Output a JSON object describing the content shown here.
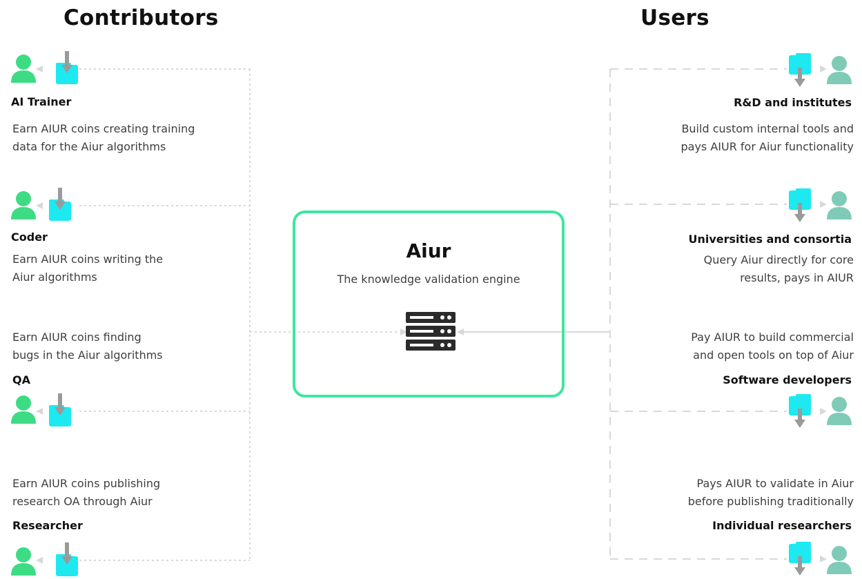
{
  "headings": {
    "contributors": "Contributors",
    "users": "Users"
  },
  "center": {
    "title": "Aiur",
    "subtitle": "The knowledge validation engine"
  },
  "contributors": [
    {
      "role": "AI Trainer",
      "desc": [
        "Earn AIUR coins creating training",
        "data for the Aiur algorithms"
      ]
    },
    {
      "role": "Coder",
      "desc": [
        "Earn AIUR coins writing the",
        "Aiur algorithms"
      ]
    },
    {
      "role": "QA",
      "desc": [
        "Earn AIUR coins finding",
        "bugs in the Aiur algorithms"
      ]
    },
    {
      "role": "Researcher",
      "desc": [
        "Earn AIUR coins publishing",
        "research OA through Aiur"
      ]
    }
  ],
  "users": [
    {
      "role": "R&D and institutes",
      "desc": [
        "Build custom internal tools and",
        "pays AIUR for Aiur functionality"
      ]
    },
    {
      "role": "Universities and consortia",
      "desc": [
        "Query Aiur directly for core",
        "results, pays in AIUR"
      ]
    },
    {
      "role": "Software developers",
      "desc": [
        "Pay AIUR to build commercial",
        "and open tools on top of Aiur"
      ]
    },
    {
      "role": "Individual researchers",
      "desc": [
        "Pays AIUR to validate in Aiur",
        "before  publishing traditionally"
      ]
    }
  ],
  "colors": {
    "contributor_person": "#3ddc84",
    "wallet": "#1de9f0",
    "user_person": "#7fcbb7",
    "box_border": "#3ee6a0",
    "connector": "#d6d6d6",
    "arrow": "#9a9a9a"
  }
}
